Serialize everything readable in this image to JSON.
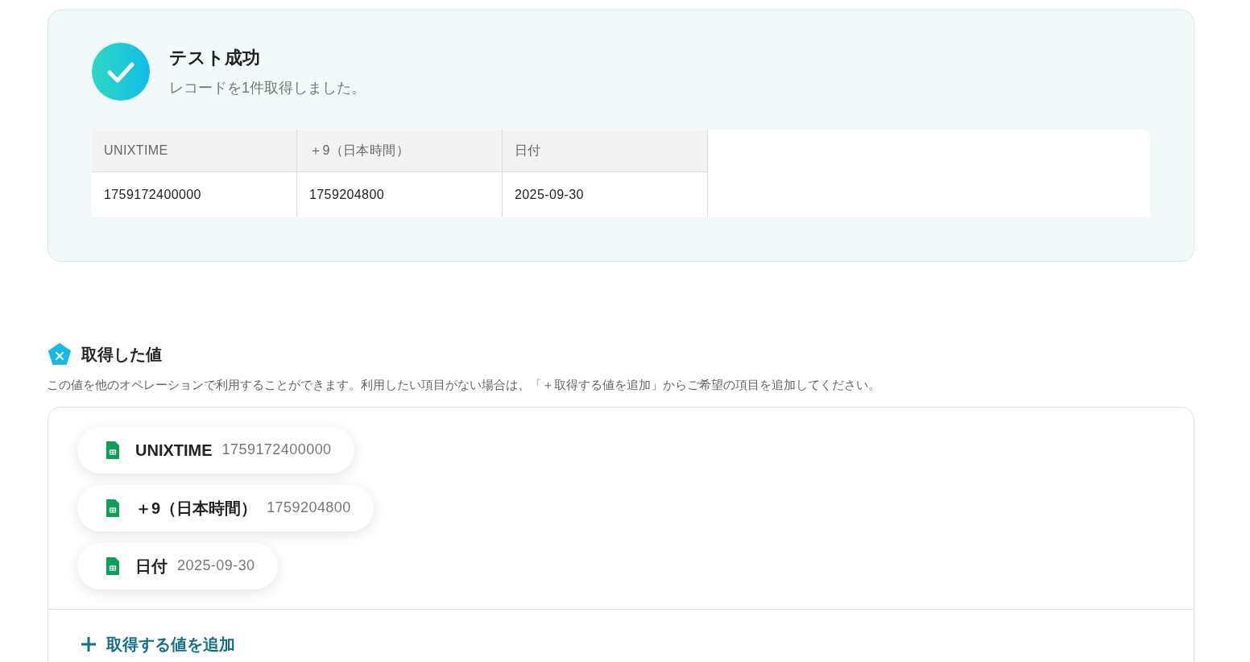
{
  "test_result": {
    "title": "テスト成功",
    "message": "レコードを1件取得しました。"
  },
  "table": {
    "columns": [
      "UNIXTIME",
      "＋9（日本時間）",
      "日付"
    ],
    "rows": [
      [
        "1759172400000",
        "1759204800",
        "2025-09-30"
      ]
    ]
  },
  "values_section": {
    "title": "取得した値",
    "description": "この値を他のオペレーションで利用することができます。利用したい項目がない場合は、「＋取得する値を追加」からご希望の項目を追加してください。",
    "items": [
      {
        "name": "UNIXTIME",
        "value": "1759172400000"
      },
      {
        "name": "＋9（日本時間）",
        "value": "1759204800"
      },
      {
        "name": "日付",
        "value": "2025-09-30"
      }
    ],
    "add_button": "取得する値を追加"
  }
}
